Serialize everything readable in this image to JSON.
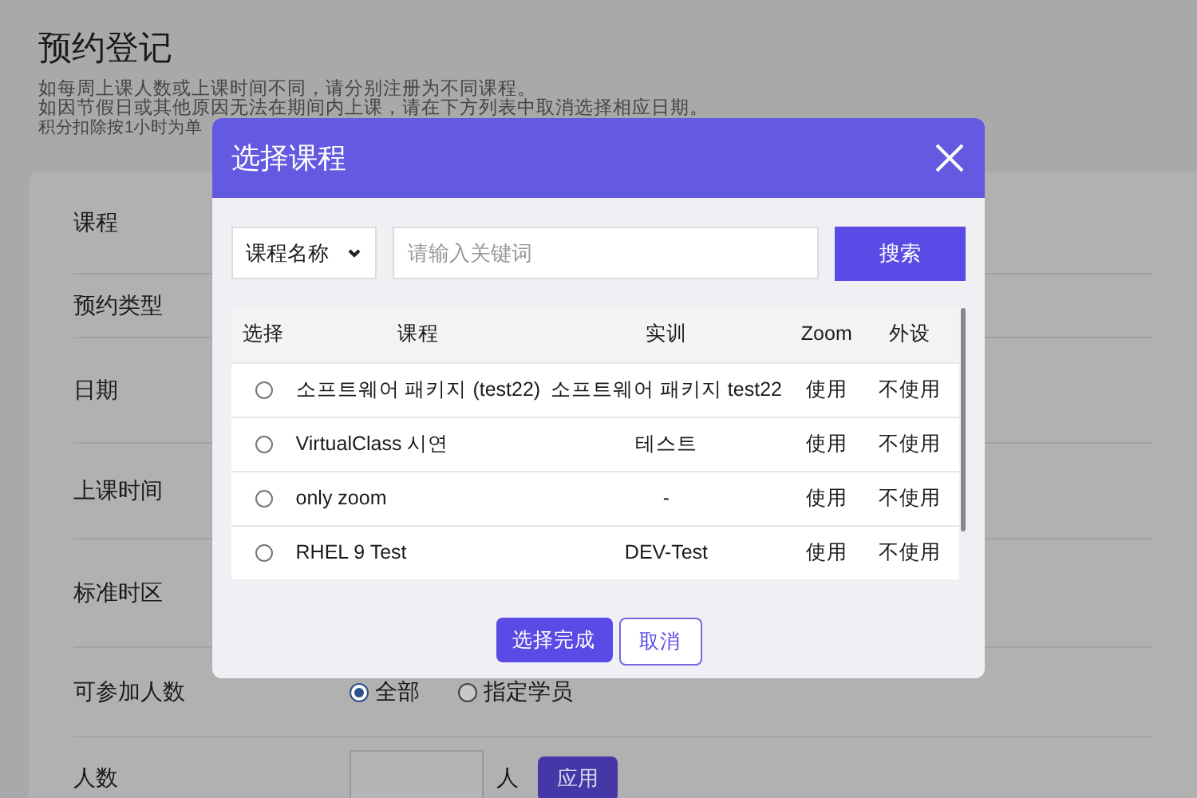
{
  "page": {
    "title": "预约登记",
    "notes": [
      "如每周上课人数或上课时间不同，请分别注册为不同课程。",
      "如因节假日或其他原因无法在期间内上课，请在下方列表中取消选择相应日期。",
      "积分扣除按1小时为单"
    ]
  },
  "form": {
    "labels": [
      "课程",
      "预约类型",
      "日期",
      "上课时间",
      "标准时区",
      "可参加人数",
      "人数"
    ],
    "participants": [
      {
        "label": "全部",
        "selected": true
      },
      {
        "label": "指定学员",
        "selected": false
      }
    ],
    "count_unit": "人",
    "apply_button": "应用"
  },
  "dialog": {
    "title": "选择课程",
    "filter": {
      "value": "课程名称"
    },
    "search": {
      "placeholder": "请输入关键词"
    },
    "search_button": "搜索",
    "table": {
      "columns": [
        "选择",
        "课程",
        "实训",
        "Zoom",
        "外设"
      ],
      "rows": [
        {
          "selected": false,
          "course": "소프트웨어 패키지 (test22)",
          "practice": "소프트웨어 패키지 test22",
          "zoom": "使用",
          "device": "不使用"
        },
        {
          "selected": false,
          "course": "VirtualClass 시연",
          "practice": "테스트",
          "zoom": "使用",
          "device": "不使用"
        },
        {
          "selected": false,
          "course": "only zoom",
          "practice": "-",
          "zoom": "使用",
          "device": "不使用"
        },
        {
          "selected": false,
          "course": "RHEL 9 Test",
          "practice": "DEV-Test",
          "zoom": "使用",
          "device": "不使用"
        }
      ]
    },
    "buttons": {
      "confirm": "选择完成",
      "cancel": "取消"
    }
  }
}
